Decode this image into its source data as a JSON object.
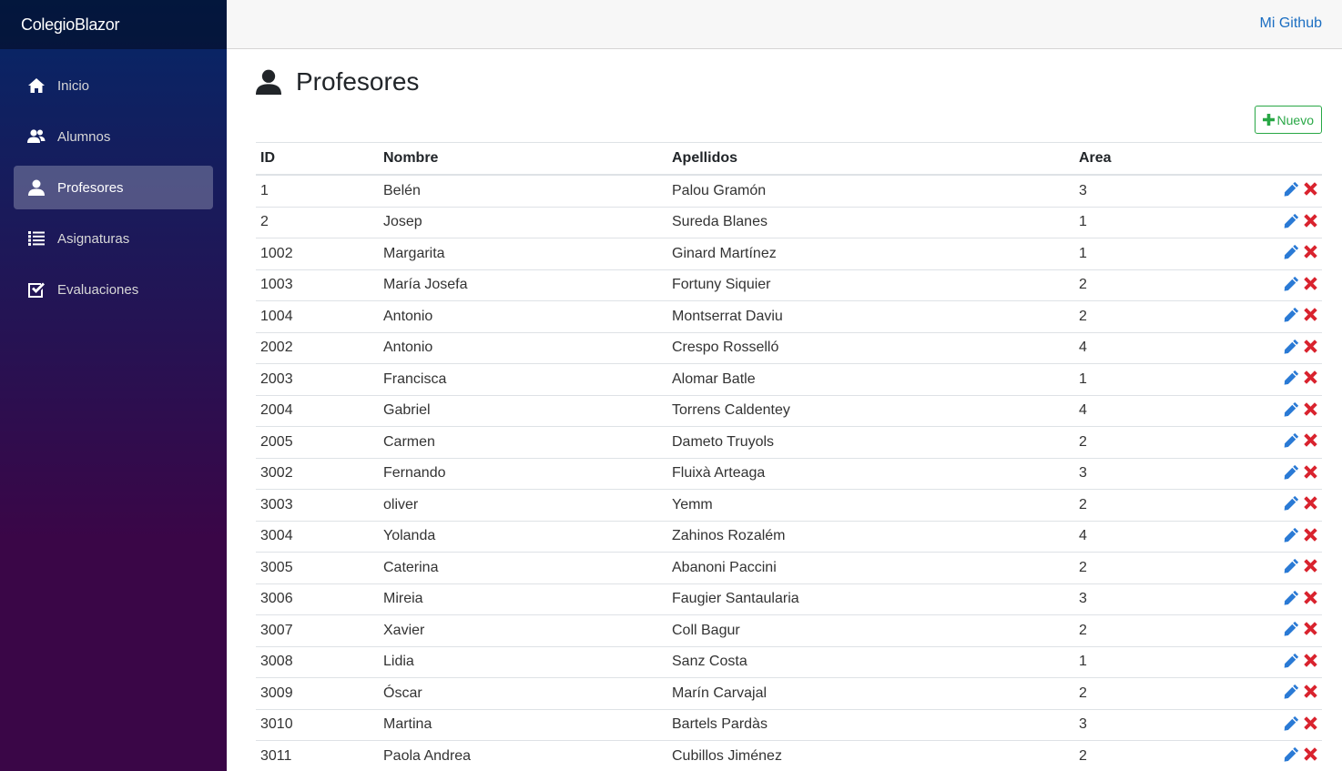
{
  "app": {
    "brand": "ColegioBlazor",
    "github_link": "Mi Github"
  },
  "sidebar": {
    "items": [
      {
        "label": "Inicio",
        "icon": "home-icon",
        "active": false
      },
      {
        "label": "Alumnos",
        "icon": "people-icon",
        "active": false
      },
      {
        "label": "Profesores",
        "icon": "person-icon",
        "active": true
      },
      {
        "label": "Asignaturas",
        "icon": "list-icon",
        "active": false
      },
      {
        "label": "Evaluaciones",
        "icon": "checkbox-icon",
        "active": false
      }
    ]
  },
  "page": {
    "title": "Profesores",
    "title_icon": "person-icon",
    "new_button": "Nuevo"
  },
  "table": {
    "headers": [
      "ID",
      "Nombre",
      "Apellidos",
      "Area"
    ],
    "rows": [
      [
        "1",
        "Belén",
        "Palou Gramón",
        "3"
      ],
      [
        "2",
        "Josep",
        "Sureda Blanes",
        "1"
      ],
      [
        "1002",
        "Margarita",
        "Ginard Martínez",
        "1"
      ],
      [
        "1003",
        "María Josefa",
        "Fortuny Siquier",
        "2"
      ],
      [
        "1004",
        "Antonio",
        "Montserrat Daviu",
        "2"
      ],
      [
        "2002",
        "Antonio",
        "Crespo Rosselló",
        "4"
      ],
      [
        "2003",
        "Francisca",
        "Alomar Batle",
        "1"
      ],
      [
        "2004",
        "Gabriel",
        "Torrens Caldentey",
        "4"
      ],
      [
        "2005",
        "Carmen",
        "Dameto Truyols",
        "2"
      ],
      [
        "3002",
        "Fernando",
        "Fluixà Arteaga",
        "3"
      ],
      [
        "3003",
        "oliver",
        "Yemm",
        "2"
      ],
      [
        "3004",
        "Yolanda",
        "Zahinos Rozalém",
        "4"
      ],
      [
        "3005",
        "Caterina",
        "Abanoni Paccini",
        "2"
      ],
      [
        "3006",
        "Mireia",
        "Faugier Santaularia",
        "3"
      ],
      [
        "3007",
        "Xavier",
        "Coll Bagur",
        "2"
      ],
      [
        "3008",
        "Lidia",
        "Sanz Costa",
        "1"
      ],
      [
        "3009",
        "Óscar",
        "Marín Carvajal",
        "2"
      ],
      [
        "3010",
        "Martina",
        "Bartels Pardàs",
        "3"
      ],
      [
        "3011",
        "Paola Andrea",
        "Cubillos Jiménez",
        "2"
      ]
    ]
  },
  "colors": {
    "sidebar_top": "#052767",
    "sidebar_bottom": "#3a0647",
    "link": "#1b6ec2",
    "success": "#28a745",
    "edit": "#2a7ad5",
    "delete": "#d9232e"
  }
}
